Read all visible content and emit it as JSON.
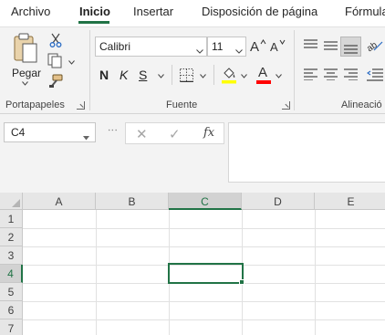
{
  "tabs": [
    "Archivo",
    "Inicio",
    "Insertar",
    "Disposición de página",
    "Fórmula"
  ],
  "active_tab": "Inicio",
  "ribbon": {
    "clipboard": {
      "paste_label": "Pegar",
      "group_label": "Portapapeles"
    },
    "font": {
      "font_name": "Calibri",
      "font_size": "11",
      "bold_label": "N",
      "italic_label": "K",
      "underline_label": "S",
      "font_color_letter": "A",
      "group_label": "Fuente"
    },
    "alignment": {
      "group_label": "Alineació"
    }
  },
  "formula_bar": {
    "name_box": "C4",
    "fx_label": "fx",
    "cancel_glyph": "✕",
    "enter_glyph": "✓",
    "formula_value": ""
  },
  "sheet": {
    "columns": [
      "A",
      "B",
      "C",
      "D",
      "E"
    ],
    "rows": [
      "1",
      "2",
      "3",
      "4",
      "5",
      "6",
      "7"
    ],
    "selected_column": "C",
    "selected_row": "4",
    "active_cell": "C4"
  },
  "colors": {
    "accent": "#217346",
    "fill_highlight": "#ffff00",
    "font_color": "#ff0000"
  }
}
